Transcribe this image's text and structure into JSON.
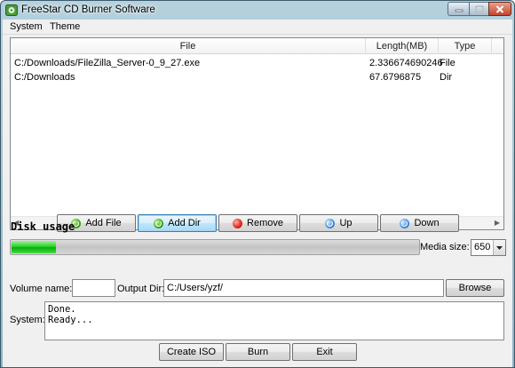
{
  "window": {
    "title": "FreeStar CD Burner Software"
  },
  "menu": {
    "items": [
      "System",
      "Theme"
    ]
  },
  "table": {
    "columns": [
      "File",
      "Length(MB)",
      "Type"
    ],
    "rows": [
      {
        "file": "C:/Downloads/FileZilla_Server-0_9_27.exe",
        "length": "2.336674690246",
        "type": "File"
      },
      {
        "file": "C:/Downloads",
        "length": "67.6796875",
        "type": "Dir"
      }
    ]
  },
  "toolbar": {
    "add_file": "Add File",
    "add_dir": "Add Dir",
    "remove": "Remove",
    "up": "Up",
    "down": "Down"
  },
  "disk": {
    "label": "Disk usage",
    "usage_fraction": 0.11,
    "media_size_label": "Media size:",
    "media_size_value": "650"
  },
  "volume": {
    "label": "Volume name:",
    "value": ""
  },
  "output": {
    "label": "Output Dir:",
    "value": "C:/Users/yzf/",
    "browse": "Browse"
  },
  "system": {
    "label": "System:",
    "log": [
      "Done.",
      "Ready..."
    ]
  },
  "actions": {
    "create_iso": "Create ISO",
    "burn": "Burn",
    "exit": "Exit"
  },
  "icons": {
    "add": "green-refresh-icon",
    "remove": "red-circle-icon",
    "move": "blue-refresh-icon"
  }
}
